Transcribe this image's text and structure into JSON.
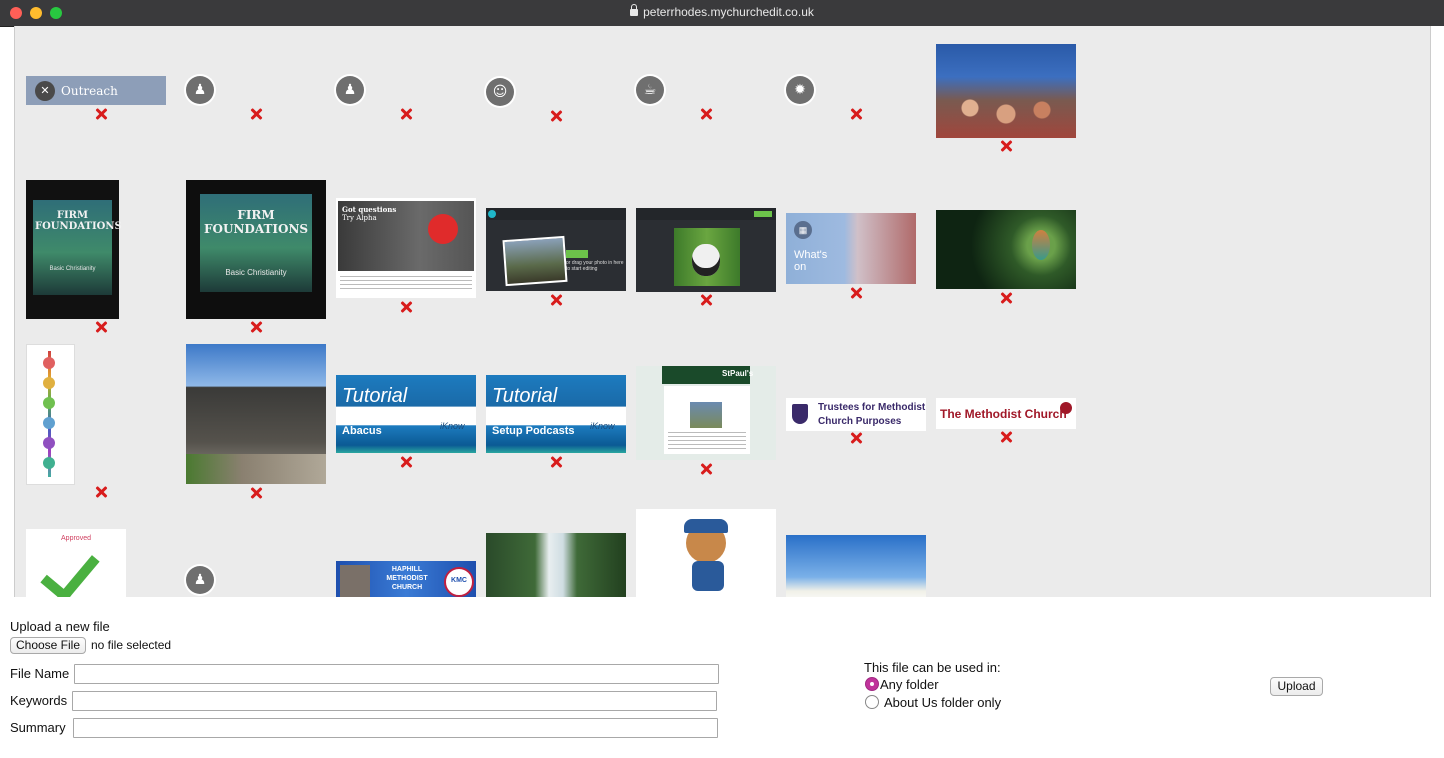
{
  "browser": {
    "url": "peterrhodes.mychurchedit.co.uk"
  },
  "gallery": {
    "outreach_label": "Outreach",
    "book_title": "FIRM FOUNDATIONS",
    "book_subtitle": "Basic Christianity",
    "alpha_heading": "Got questions",
    "alpha_sub": "Try Alpha",
    "drop_text": "or drag your photo in here to start editing",
    "whats_on_label": "What's on",
    "tutorial_title": "Tutorial",
    "tutorial_1_topic": "Abacus",
    "tutorial_2_topic": "Setup Podcasts",
    "ikm_brand": "iKnow",
    "stpauls_brand": "StPaul's",
    "trustees_label": "Trustees for Methodist Church Purposes",
    "methodist_label": "The Methodist Church",
    "approved_label": "Approved",
    "church_banner": "HAPHILL METHODIST CHURCH",
    "kmc_label": "KMC"
  },
  "upload": {
    "heading": "Upload a new file",
    "choose_file": "Choose File",
    "no_file": "no file selected",
    "file_name_label": "File Name",
    "keywords_label": "Keywords",
    "summary_label": "Summary",
    "file_name_value": "",
    "keywords_value": "",
    "summary_value": "",
    "usage_heading": "This file can be used in:",
    "option_any": "Any folder",
    "option_about": "About Us folder only",
    "selected_option": "Any folder",
    "upload_button": "Upload"
  },
  "colors": {
    "accent_radio": "#c0339b",
    "delete_icon": "#d81c1c",
    "outreach_bg": "#8d9eb8"
  }
}
